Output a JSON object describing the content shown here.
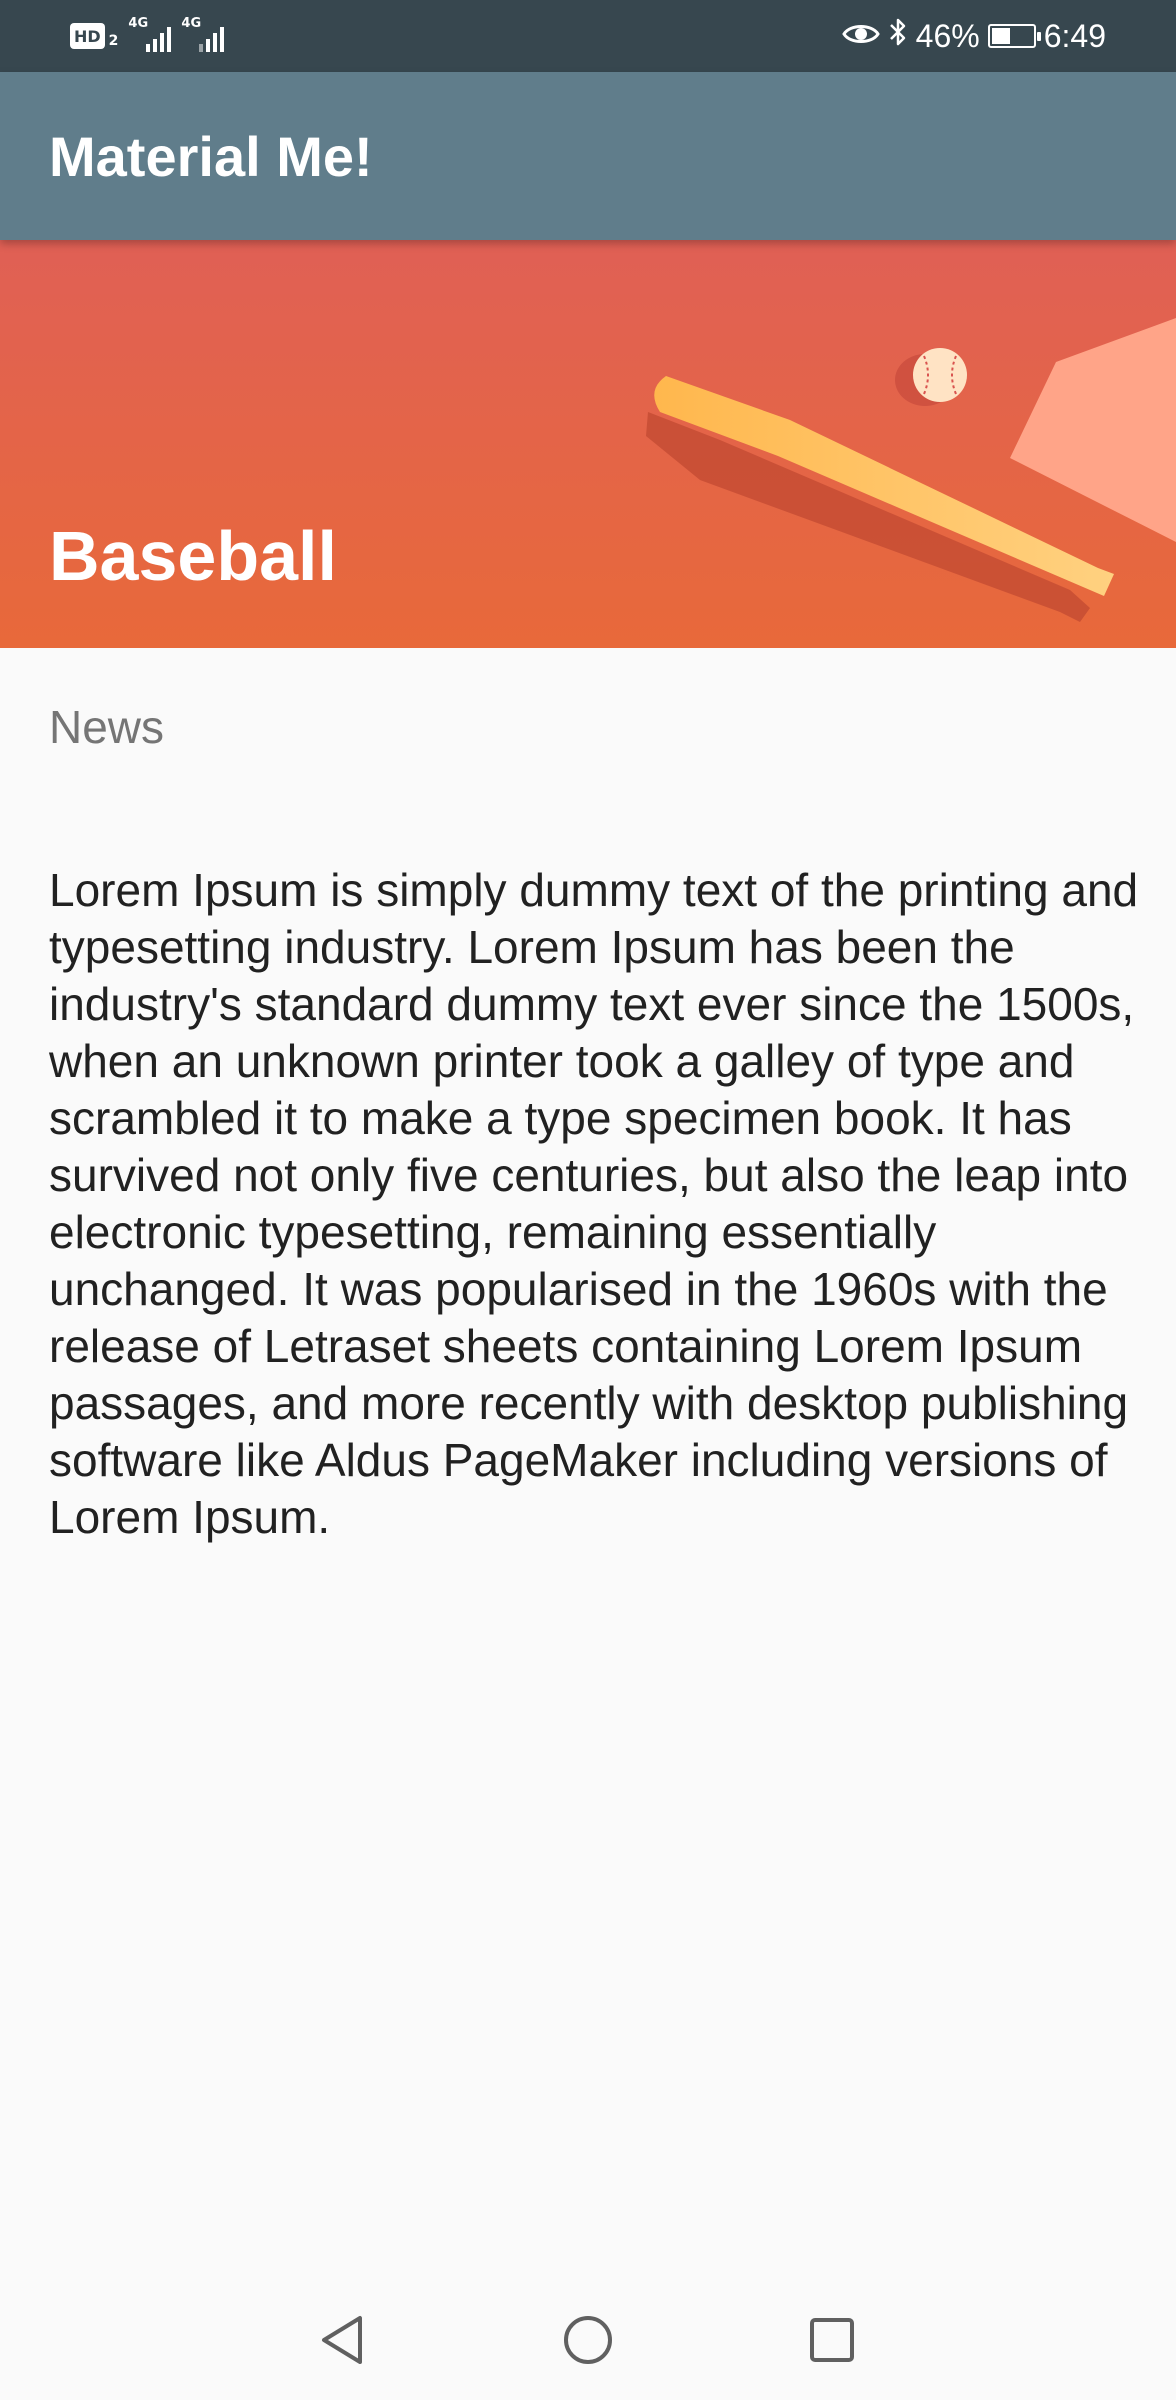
{
  "status_bar": {
    "hd": "HD",
    "hd_sub": "2",
    "network_1": "4G",
    "network_2": "4G",
    "battery_percent": "46%",
    "battery_level": 0.46,
    "time": "6:49"
  },
  "app_bar": {
    "title": "Material Me!"
  },
  "header": {
    "title": "Baseball",
    "colors": {
      "top": "#e06055",
      "bottom": "#e8693a"
    }
  },
  "content": {
    "subtitle": "News",
    "body": "Lorem Ipsum is simply dummy text of the printing and typesetting industry. Lorem Ipsum has been the industry's standard dummy text ever since the 1500s, when an unknown printer took a galley of type and scrambled it to make a type specimen book. It has survived not only five centuries, but also the leap into electronic typesetting, remaining essentially unchanged. It was popularised in the 1960s with the release of Letraset sheets containing Lorem Ipsum passages, and more recently with desktop publishing software like Aldus PageMaker including versions of Lorem Ipsum."
  },
  "nav": {
    "back_icon": "back-triangle-icon",
    "home_icon": "home-circle-icon",
    "recents_icon": "recents-square-icon"
  }
}
